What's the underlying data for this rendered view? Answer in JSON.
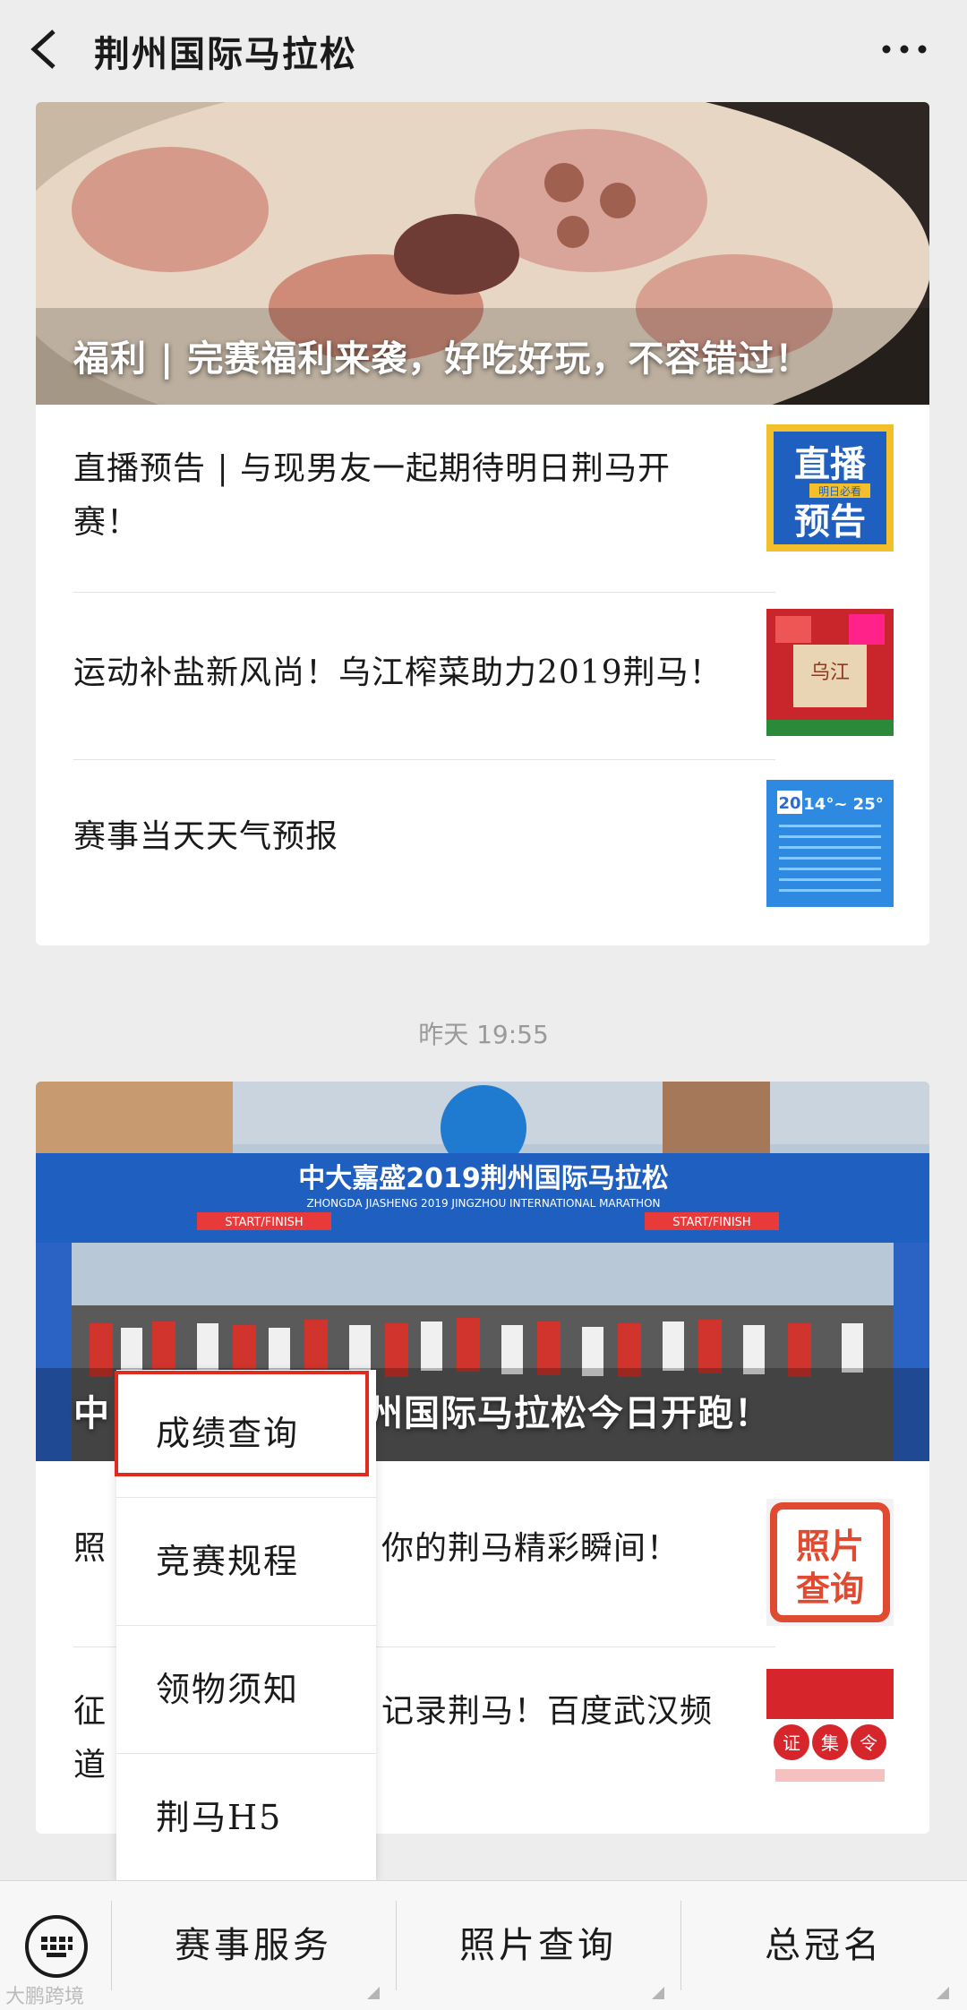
{
  "header": {
    "title": "荆州国际马拉松",
    "back_icon": "chevron-left-icon",
    "more_icon": "more-horizontal-icon"
  },
  "article_group_1": {
    "hero_title": "福利 | 完赛福利来袭，好吃好玩，不容错过！",
    "items": [
      {
        "title": "直播预告 | 与现男友一起期待明日荆马开赛！",
        "thumb_text_1": "直播",
        "thumb_text_2": "预告",
        "thumb_tag": "明日必看"
      },
      {
        "title": "运动补盐新风尚！乌江榨菜助力2019荆马！",
        "thumb_text_1": "乌江"
      },
      {
        "title": "赛事当天天气预报",
        "thumb_text_1": "20",
        "thumb_text_2": "14°~ 25°"
      }
    ]
  },
  "timestamp": "昨天 19:55",
  "article_group_2": {
    "banner_text": "中大嘉盛2019荆州国际马拉松",
    "banner_sub": "ZHONGDA JIASHENG 2019 JINGZHOU INTERNATIONAL MARATHON",
    "start_finish": "START/FINISH",
    "hero_title_left": "中",
    "hero_title_right": "州国际马拉松今日开跑！",
    "items": [
      {
        "title_left": "照",
        "title_right": "你的荆马精彩瞬间！",
        "thumb_text_1": "照片",
        "thumb_text_2": "查询"
      },
      {
        "title_left_1": "征",
        "title_right_1": "记录荆马！百度武汉频",
        "title_left_2": "道",
        "thumb_text_1": "证",
        "thumb_text_2": "集",
        "thumb_text_3": "令"
      }
    ]
  },
  "popup_menu": {
    "items": [
      "成绩查询",
      "竞赛规程",
      "领物须知",
      "荆马H5"
    ],
    "highlighted": "成绩查询"
  },
  "bottom_bar": {
    "keyboard_icon": "keyboard-icon",
    "tabs": [
      "赛事服务",
      "照片查询",
      "总冠名"
    ]
  },
  "watermark": "大鹏跨境",
  "colors": {
    "highlight": "#e02b20",
    "background": "#ededed"
  }
}
